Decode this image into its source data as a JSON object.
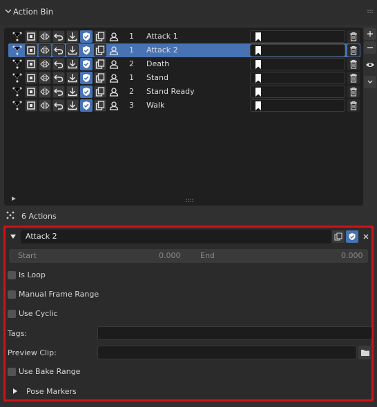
{
  "header": {
    "title": "Action Bin"
  },
  "actions": [
    {
      "count": "1",
      "name": "Attack 1",
      "selected": false
    },
    {
      "count": "1",
      "name": "Attack 2",
      "selected": true
    },
    {
      "count": "2",
      "name": "Death",
      "selected": false
    },
    {
      "count": "1",
      "name": "Stand",
      "selected": false
    },
    {
      "count": "2",
      "name": "Stand Ready",
      "selected": false
    },
    {
      "count": "3",
      "name": "Walk",
      "selected": false
    }
  ],
  "summary": {
    "text": "6 Actions"
  },
  "details": {
    "name_value": "Attack 2",
    "start_label": "Start",
    "start_value": "0.000",
    "end_label": "End",
    "end_value": "0.000",
    "is_loop": "Is Loop",
    "manual_frame_range": "Manual Frame Range",
    "use_cyclic": "Use Cyclic",
    "tags_label": "Tags:",
    "preview_clip_label": "Preview Clip:",
    "use_bake_range": "Use Bake Range",
    "pose_markers": "Pose Markers"
  },
  "colors": {
    "accent": "#4772b3",
    "highlight_border": "#d0121a"
  }
}
